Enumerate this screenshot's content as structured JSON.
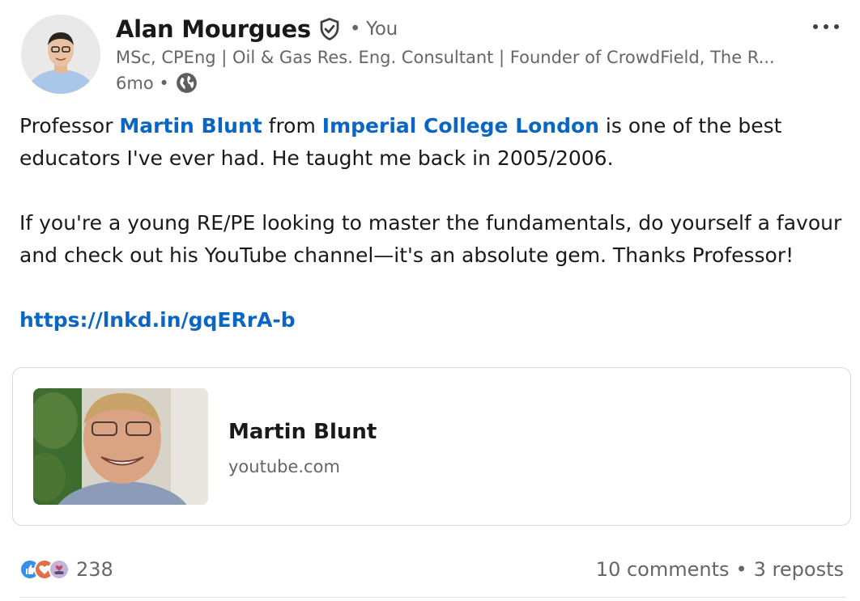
{
  "post": {
    "author": {
      "name": "Alan Mourgues",
      "relation": "• You",
      "headline": "MSc, CPEng | Oil & Gas Res. Eng. Consultant | Founder of CrowdField, The R...",
      "time": "6mo •",
      "verified_icon": "verified-shield-icon",
      "visibility_icon": "globe-icon"
    },
    "more_icon": "more-options-icon",
    "body": {
      "p1_pre": "Professor ",
      "mention1": "Martin Blunt",
      "p1_mid": " from ",
      "mention2": "Imperial College London",
      "p1_post": " is one of the best educators I've ever had. He taught me back in 2005/2006.",
      "p2": "If you're a young RE/PE looking to master the fundamentals, do yourself a favour and check out his YouTube channel—it's an absolute gem. Thanks Professor!",
      "link": "https://lnkd.in/gqERrA-b"
    },
    "link_card": {
      "title": "Martin Blunt",
      "source": "youtube.com"
    },
    "social": {
      "reaction_icons": [
        "like-icon",
        "love-icon",
        "support-icon"
      ],
      "reactions_count": "238",
      "comments": "10 comments",
      "separator": "•",
      "reposts": "3 reposts"
    },
    "colors": {
      "link": "#0a66c2",
      "secondary_text": "#666666",
      "primary_text": "#191919"
    }
  }
}
